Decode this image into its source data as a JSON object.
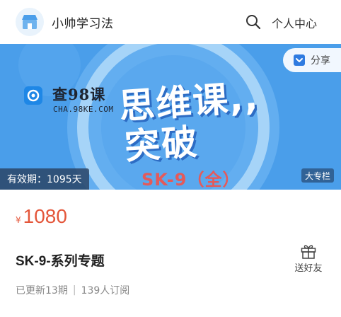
{
  "header": {
    "shop_name": "小帅学习法",
    "profile_label": "个人中心",
    "icons": {
      "shop": "shop-icon",
      "search": "search-icon"
    }
  },
  "banner": {
    "share_label": "分享",
    "brand_name": "查98课",
    "brand_domain": "CHA.98KE.COM",
    "title_line1": "思维课,,",
    "title_line2": "突破",
    "subtitle": "SK-9（全）",
    "validity": "有效期：1095天",
    "tag": "大专栏",
    "colors": {
      "background": "#4a9eea",
      "ring": "#9fd0f7",
      "title": "#ffffff",
      "subtitle": "#e45a5a"
    }
  },
  "product": {
    "currency": "¥",
    "price": "1080",
    "title": "SK-9-系列专题",
    "gift_label": "送好友",
    "updated": "已更新13期",
    "separator": "|",
    "subscribers": "139人订阅",
    "colors": {
      "price": "#e4563a"
    }
  }
}
